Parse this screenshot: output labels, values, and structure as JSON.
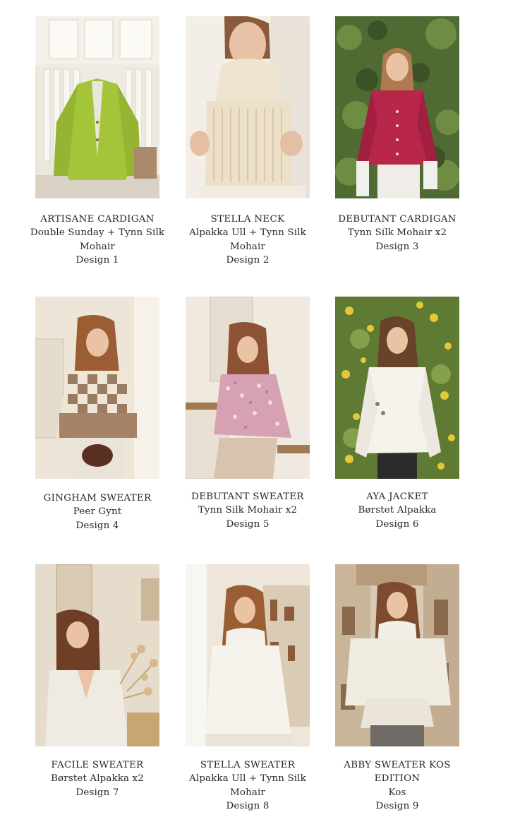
{
  "designs": [
    {
      "title": "ARTISANE CARDIGAN",
      "yarn": "Double Sunday + Tynn Silk Mohair",
      "design": "Design 1",
      "photo_alt": "green cardigan on hanger"
    },
    {
      "title": "STELLA NECK",
      "yarn": "Alpakka Ull + Tynn Silk Mohair",
      "design": "Design 2",
      "photo_alt": "cream ribbed turtleneck vest"
    },
    {
      "title": "DEBUTANT CARDIGAN",
      "yarn": "Tynn Silk Mohair x2",
      "design": "Design 3",
      "photo_alt": "raspberry cardigan"
    },
    {
      "title": "GINGHAM SWEATER",
      "yarn": "Peer Gynt",
      "design": "Design 4",
      "photo_alt": "brown gingham sweater"
    },
    {
      "title": "DEBUTANT SWEATER",
      "yarn": "Tynn Silk Mohair x2",
      "design": "Design 5",
      "photo_alt": "pink speckled sweater"
    },
    {
      "title": "AYA JACKET",
      "yarn": "Børstet Alpakka",
      "design": "Design 6",
      "photo_alt": "white brushed jacket"
    },
    {
      "title": "FACILE SWEATER",
      "yarn": "Børstet Alpakka x2",
      "design": "Design 7",
      "photo_alt": "white v-neck sweater"
    },
    {
      "title": "STELLA SWEATER",
      "yarn": "Alpakka Ull + Tynn Silk Mohair",
      "design": "Design 8",
      "photo_alt": "white turtleneck sweater"
    },
    {
      "title": "ABBY SWEATER KOS EDITION",
      "yarn": "Kos",
      "design": "Design 9",
      "photo_alt": "off-white oversized turtleneck"
    }
  ]
}
